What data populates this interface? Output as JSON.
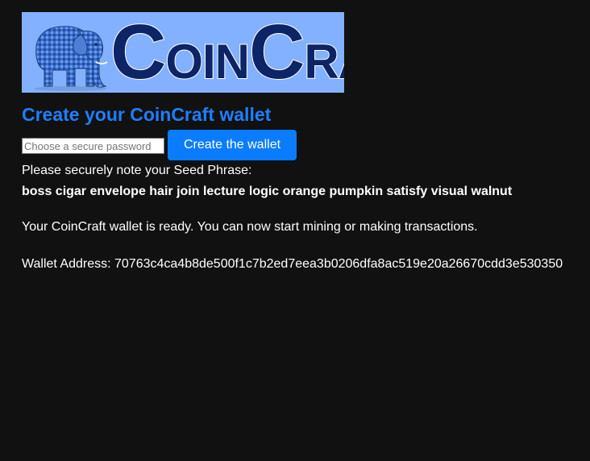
{
  "logo": {
    "text": "CoinCraft",
    "text_initials": [
      "C",
      "C"
    ],
    "text_parts": [
      "OIN",
      "RAFT"
    ],
    "background_color": "#84b1ff",
    "text_color": "#0d2466",
    "icon": "elephant-icon"
  },
  "title": "Create your CoinCraft wallet",
  "password_input": {
    "placeholder": "Choose a secure password",
    "value": ""
  },
  "create_button": {
    "label": "Create the wallet",
    "color": "#0a7cff"
  },
  "seed": {
    "label": "Please securely note your Seed Phrase:",
    "phrase": "boss cigar envelope hair join lecture logic orange pumpkin satisfy visual walnut"
  },
  "status_message": "Your CoinCraft wallet is ready. You can now start mining or making transactions.",
  "wallet_address": "Wallet Address: 70763c4ca4b8de500f1c7b2ed7eea3b0206dfa8ac519e20a26670cdd3e530350",
  "colors": {
    "page_background": "#111111",
    "title": "#1f7eff",
    "text": "#ffffff"
  }
}
